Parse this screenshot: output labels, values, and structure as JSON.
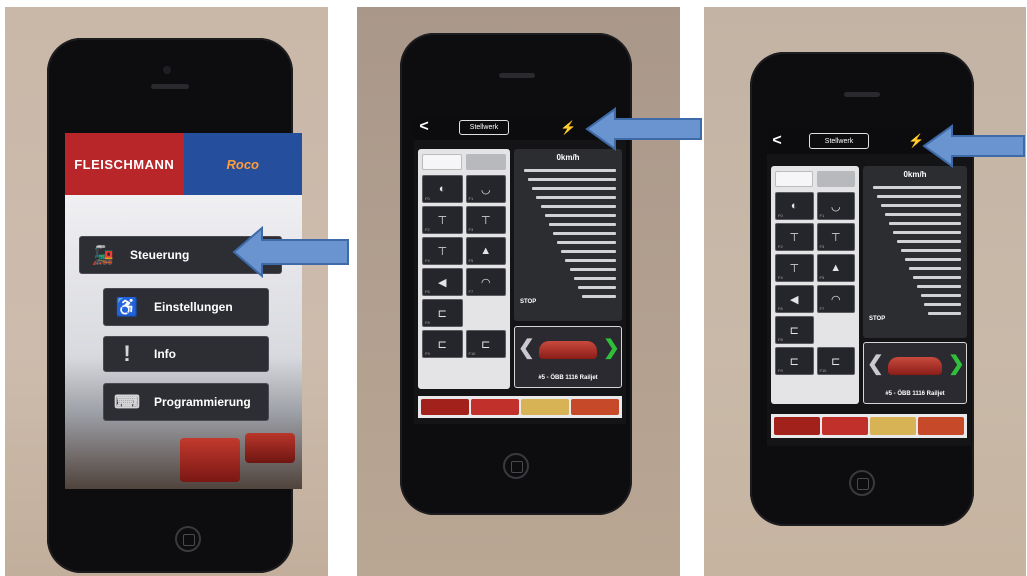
{
  "menu_screen": {
    "brand_left": "FLEISCHMANN",
    "brand_right": "Roco",
    "items": [
      {
        "label": "Steuerung",
        "icon": "locomotive-icon"
      },
      {
        "label": "Einstellungen",
        "icon": "wheelchair-icon"
      },
      {
        "label": "Info",
        "icon": "info-icon"
      },
      {
        "label": "Programmierung",
        "icon": "keyboard-icon"
      }
    ]
  },
  "control_screen_a": {
    "back_label": "<",
    "stellwerk_label": "Stellwerk",
    "connection_icon": "plug-icon",
    "connection_color": "#d8d0c8",
    "tabs": [
      "",
      ""
    ],
    "speed_label": "0km/h",
    "stop_label": "STOP",
    "loco_name": "#5 - ÖBB 1116 Railjet"
  },
  "control_screen_b": {
    "back_label": "<",
    "stellwerk_label": "Stellwerk",
    "connection_icon": "plug-icon",
    "connection_color": "#27c43a",
    "tabs": [
      "",
      ""
    ],
    "speed_label": "0km/h",
    "stop_label": "STOP",
    "loco_name": "#5 - ÖBB 1116 Railjet"
  },
  "annotation": {
    "arrow_color": "#6a94cf",
    "arrow_border": "#3f6aa8"
  }
}
